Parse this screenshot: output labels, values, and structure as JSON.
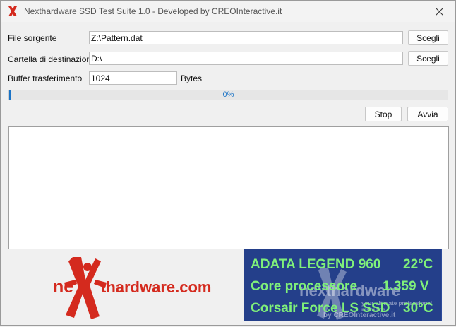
{
  "window": {
    "title": "Nexthardware SSD Test Suite 1.0 - Developed by CREOInteractive.it"
  },
  "form": {
    "source_label": "File sorgente",
    "source_value": "Z:\\Pattern.dat",
    "dest_label": "Cartella di destinazione",
    "dest_value": "D:\\",
    "buffer_label": "Buffer trasferimento",
    "buffer_value": "1024",
    "buffer_unit": "Bytes",
    "browse_label": "Scegli"
  },
  "progress": {
    "value": 0,
    "text": "0%"
  },
  "buttons": {
    "stop": "Stop",
    "start": "Avvia"
  },
  "logo": {
    "text_left": "ne",
    "text_right": "thardware.com"
  },
  "status": {
    "line1_name": "ADATA LEGEND 960",
    "line1_value": "22°C",
    "line2_name": "Core processore",
    "line2_value": "1.359 V",
    "line3_name": "Corsair Force LS SSD",
    "line3_value": "30°C",
    "watermark_brand": "nexthardware",
    "watermark_tagline": "your ultimate professional resource",
    "watermark_by": "by CREOInteractive.it"
  },
  "colors": {
    "panel_bg": "#243f8a",
    "panel_text": "#7ff07a",
    "logo_red": "#d42a1e",
    "progress_accent": "#1a73c6"
  }
}
